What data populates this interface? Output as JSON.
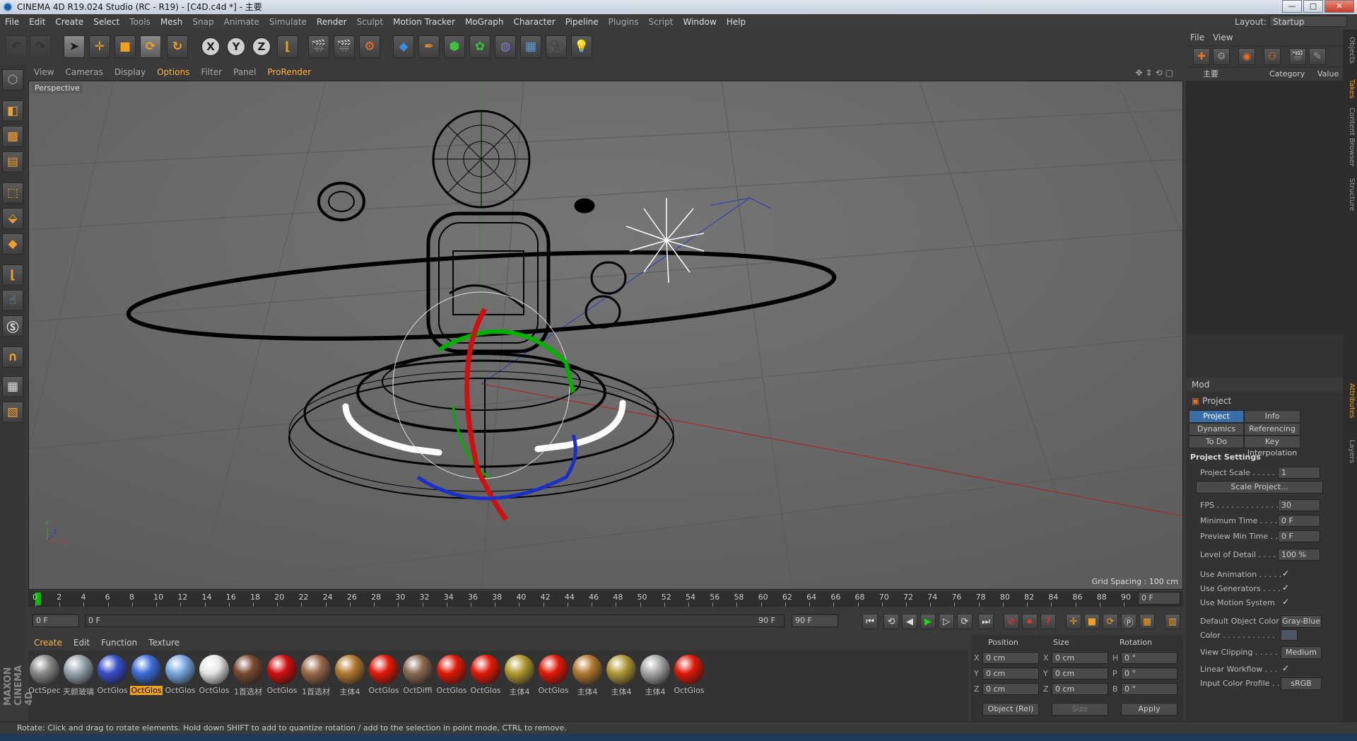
{
  "window": {
    "title": "CINEMA 4D R19.024 Studio (RC - R19) - [C4D.c4d *] - 主要",
    "minimize": "—",
    "maximize": "□",
    "close": "✕"
  },
  "menu": [
    "File",
    "Edit",
    "Create",
    "Select",
    "Tools",
    "Mesh",
    "Snap",
    "Animate",
    "Simulate",
    "Render",
    "Sculpt",
    "Motion Tracker",
    "MoGraph",
    "Character",
    "Pipeline",
    "Plugins",
    "Script",
    "Window",
    "Help"
  ],
  "layout": {
    "label": "Layout:",
    "value": "Startup"
  },
  "toolbar": {
    "x": "X",
    "y": "Y",
    "z": "Z"
  },
  "viewport": {
    "menu": [
      "View",
      "Cameras",
      "Display",
      "Options",
      "Filter",
      "Panel",
      "ProRender"
    ],
    "active_menu": "Options",
    "camera_label": "Perspective",
    "grid_spacing": "Grid Spacing : 100 cm",
    "nav_icons": "✥⇕⟲▢"
  },
  "timeline": {
    "ticks": [
      "0",
      "2",
      "4",
      "6",
      "8",
      "10",
      "12",
      "14",
      "16",
      "18",
      "20",
      "22",
      "24",
      "26",
      "28",
      "30",
      "32",
      "34",
      "36",
      "38",
      "40",
      "42",
      "44",
      "46",
      "48",
      "50",
      "52",
      "54",
      "56",
      "58",
      "60",
      "62",
      "64",
      "66",
      "68",
      "70",
      "72",
      "74",
      "76",
      "78",
      "80",
      "82",
      "84",
      "86",
      "88",
      "90"
    ],
    "current_frame": "0 F",
    "start": "0 F",
    "range_start": "0 F",
    "range_end": "90 F",
    "end": "90 F"
  },
  "materials": {
    "menu": [
      "Create",
      "Edit",
      "Function",
      "Texture"
    ],
    "active_menu": "Create",
    "items": [
      {
        "name": "OctSpec",
        "color": "#8a8a8a"
      },
      {
        "name": "天颜玻璃",
        "color": "#9aa6ae"
      },
      {
        "name": "OctGlos",
        "color": "#3a4fc8"
      },
      {
        "name": "OctGlos",
        "color": "#3d6ed8",
        "selected": true
      },
      {
        "name": "OctGlos",
        "color": "#79a9de"
      },
      {
        "name": "OctGlos",
        "color": "#e6e6e6"
      },
      {
        "name": "1首选材",
        "color": "#7a4a32"
      },
      {
        "name": "OctGlos",
        "color": "#d01010"
      },
      {
        "name": "1首选材",
        "color": "#9a6a4a"
      },
      {
        "name": "主体4",
        "color": "#b07a30"
      },
      {
        "name": "OctGlos",
        "color": "#e01a0a"
      },
      {
        "name": "OctDiffi",
        "color": "#8a6a52"
      },
      {
        "name": "OctGlos",
        "color": "#e01a0a"
      },
      {
        "name": "OctGlos",
        "color": "#e01a0a"
      },
      {
        "name": "主体4",
        "color": "#b09a30"
      },
      {
        "name": "OctGlos",
        "color": "#e01a0a"
      },
      {
        "name": "主体4",
        "color": "#b07a30"
      },
      {
        "name": "主体4",
        "color": "#b0983a"
      },
      {
        "name": "主体4",
        "color": "#a8a8a8"
      },
      {
        "name": "OctGlos",
        "color": "#e01a0a"
      }
    ]
  },
  "coordinates": {
    "headers": {
      "position": "Position",
      "size": "Size",
      "rotation": "Rotation"
    },
    "rows": [
      {
        "axis": "X",
        "pos": "0 cm",
        "size_axis": "X",
        "size": "0 cm",
        "rot_axis": "H",
        "rot": "0 °"
      },
      {
        "axis": "Y",
        "pos": "0 cm",
        "size_axis": "Y",
        "size": "0 cm",
        "rot_axis": "P",
        "rot": "0 °"
      },
      {
        "axis": "Z",
        "pos": "0 cm",
        "size_axis": "Z",
        "size": "0 cm",
        "rot_axis": "B",
        "rot": "0 °"
      }
    ],
    "mode": "Object (Rel)",
    "size_mode": "Size",
    "apply": "Apply"
  },
  "objects": {
    "menu": [
      "File",
      "View"
    ],
    "columns": {
      "name": "主要",
      "category": "Category",
      "value": "Value"
    }
  },
  "attributes": {
    "header": "Mod",
    "title": "Project",
    "tabs": [
      {
        "label": "Project Settings",
        "active": true
      },
      {
        "label": "Info"
      },
      {
        "label": "Dynamics"
      },
      {
        "label": "Referencing"
      },
      {
        "label": "To Do"
      },
      {
        "label": "Key Interpolation"
      }
    ],
    "section": "Project Settings",
    "project_scale_label": "Project Scale . . . . . .",
    "project_scale": "1",
    "scale_button": "Scale Project...",
    "fps_label": "FPS . . . . . . . . . . . . . .",
    "fps": "30",
    "min_time_label": "Minimum Time . . . . .",
    "min_time": "0 F",
    "preview_min_label": "Preview Min Time . . .",
    "preview_min": "0 F",
    "lod_label": "Level of Detail . . . . .",
    "lod": "100 %",
    "use_animation": "Use Animation . . . . .",
    "use_generators": "Use Generators . . . .",
    "use_motion": "Use Motion System",
    "check": "✓",
    "default_color_label": "Default Object Color",
    "default_color": "Gray-Blue",
    "color_label": "Color . . . . . . . . . . .",
    "view_clipping_label": "View Clipping . . . . .",
    "view_clipping": "Medium",
    "linear_label": "Linear Workflow . . .",
    "input_profile_label": "Input Color Profile . .",
    "input_profile": "sRGB"
  },
  "side_tabs": [
    "Objects",
    "Takes",
    "Content Browser",
    "Structure",
    "Attributes",
    "Layers"
  ],
  "status": "Rotate: Click and drag to rotate elements. Hold down SHIFT to add to quantize rotation / add to the selection in point mode, CTRL to remove.",
  "brand": "MAXON CINEMA 4D"
}
